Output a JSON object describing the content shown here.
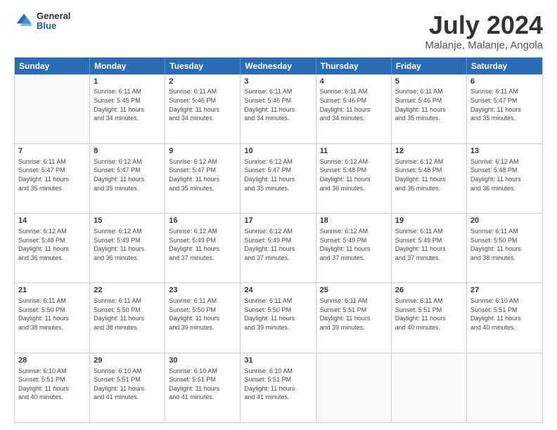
{
  "header": {
    "logo_general": "General",
    "logo_blue": "Blue",
    "main_title": "July 2024",
    "subtitle": "Malanje, Malanje, Angola"
  },
  "calendar": {
    "days": [
      "Sunday",
      "Monday",
      "Tuesday",
      "Wednesday",
      "Thursday",
      "Friday",
      "Saturday"
    ],
    "weeks": [
      [
        {
          "day": "",
          "info": ""
        },
        {
          "day": "1",
          "info": "Sunrise: 6:11 AM\nSunset: 5:45 PM\nDaylight: 11 hours\nand 34 minutes."
        },
        {
          "day": "2",
          "info": "Sunrise: 6:11 AM\nSunset: 5:46 PM\nDaylight: 11 hours\nand 34 minutes."
        },
        {
          "day": "3",
          "info": "Sunrise: 6:11 AM\nSunset: 5:46 PM\nDaylight: 11 hours\nand 34 minutes."
        },
        {
          "day": "4",
          "info": "Sunrise: 6:11 AM\nSunset: 5:46 PM\nDaylight: 11 hours\nand 34 minutes."
        },
        {
          "day": "5",
          "info": "Sunrise: 6:11 AM\nSunset: 5:46 PM\nDaylight: 11 hours\nand 35 minutes."
        },
        {
          "day": "6",
          "info": "Sunrise: 6:11 AM\nSunset: 5:47 PM\nDaylight: 11 hours\nand 35 minutes."
        }
      ],
      [
        {
          "day": "7",
          "info": "Sunrise: 6:11 AM\nSunset: 5:47 PM\nDaylight: 11 hours\nand 35 minutes."
        },
        {
          "day": "8",
          "info": "Sunrise: 6:12 AM\nSunset: 5:47 PM\nDaylight: 11 hours\nand 35 minutes."
        },
        {
          "day": "9",
          "info": "Sunrise: 6:12 AM\nSunset: 5:47 PM\nDaylight: 11 hours\nand 35 minutes."
        },
        {
          "day": "10",
          "info": "Sunrise: 6:12 AM\nSunset: 5:47 PM\nDaylight: 11 hours\nand 35 minutes."
        },
        {
          "day": "11",
          "info": "Sunrise: 6:12 AM\nSunset: 5:48 PM\nDaylight: 11 hours\nand 36 minutes."
        },
        {
          "day": "12",
          "info": "Sunrise: 6:12 AM\nSunset: 5:48 PM\nDaylight: 11 hours\nand 36 minutes."
        },
        {
          "day": "13",
          "info": "Sunrise: 6:12 AM\nSunset: 5:48 PM\nDaylight: 11 hours\nand 36 minutes."
        }
      ],
      [
        {
          "day": "14",
          "info": "Sunrise: 6:12 AM\nSunset: 5:48 PM\nDaylight: 11 hours\nand 36 minutes."
        },
        {
          "day": "15",
          "info": "Sunrise: 6:12 AM\nSunset: 5:49 PM\nDaylight: 11 hours\nand 36 minutes."
        },
        {
          "day": "16",
          "info": "Sunrise: 6:12 AM\nSunset: 5:49 PM\nDaylight: 11 hours\nand 37 minutes."
        },
        {
          "day": "17",
          "info": "Sunrise: 6:12 AM\nSunset: 5:49 PM\nDaylight: 11 hours\nand 37 minutes."
        },
        {
          "day": "18",
          "info": "Sunrise: 6:12 AM\nSunset: 5:49 PM\nDaylight: 11 hours\nand 37 minutes."
        },
        {
          "day": "19",
          "info": "Sunrise: 6:11 AM\nSunset: 5:49 PM\nDaylight: 11 hours\nand 37 minutes."
        },
        {
          "day": "20",
          "info": "Sunrise: 6:11 AM\nSunset: 5:50 PM\nDaylight: 11 hours\nand 38 minutes."
        }
      ],
      [
        {
          "day": "21",
          "info": "Sunrise: 6:11 AM\nSunset: 5:50 PM\nDaylight: 11 hours\nand 38 minutes."
        },
        {
          "day": "22",
          "info": "Sunrise: 6:11 AM\nSunset: 5:50 PM\nDaylight: 11 hours\nand 38 minutes."
        },
        {
          "day": "23",
          "info": "Sunrise: 6:11 AM\nSunset: 5:50 PM\nDaylight: 11 hours\nand 39 minutes."
        },
        {
          "day": "24",
          "info": "Sunrise: 6:11 AM\nSunset: 5:50 PM\nDaylight: 11 hours\nand 39 minutes."
        },
        {
          "day": "25",
          "info": "Sunrise: 6:11 AM\nSunset: 5:51 PM\nDaylight: 11 hours\nand 39 minutes."
        },
        {
          "day": "26",
          "info": "Sunrise: 6:11 AM\nSunset: 5:51 PM\nDaylight: 11 hours\nand 40 minutes."
        },
        {
          "day": "27",
          "info": "Sunrise: 6:10 AM\nSunset: 5:51 PM\nDaylight: 11 hours\nand 40 minutes."
        }
      ],
      [
        {
          "day": "28",
          "info": "Sunrise: 6:10 AM\nSunset: 5:51 PM\nDaylight: 11 hours\nand 40 minutes."
        },
        {
          "day": "29",
          "info": "Sunrise: 6:10 AM\nSunset: 5:51 PM\nDaylight: 11 hours\nand 41 minutes."
        },
        {
          "day": "30",
          "info": "Sunrise: 6:10 AM\nSunset: 5:51 PM\nDaylight: 11 hours\nand 41 minutes."
        },
        {
          "day": "31",
          "info": "Sunrise: 6:10 AM\nSunset: 5:51 PM\nDaylight: 11 hours\nand 41 minutes."
        },
        {
          "day": "",
          "info": ""
        },
        {
          "day": "",
          "info": ""
        },
        {
          "day": "",
          "info": ""
        }
      ]
    ]
  }
}
